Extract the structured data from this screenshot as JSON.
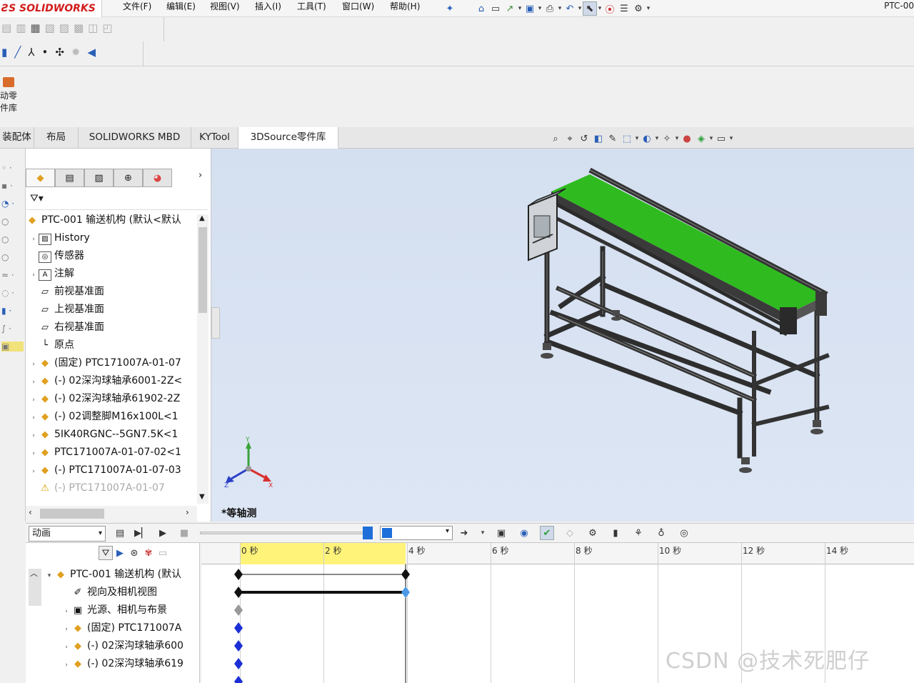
{
  "app": {
    "logo_text": "SOLIDWORKS",
    "product_text": "PTC-00"
  },
  "menu": [
    "文件(F)",
    "编辑(E)",
    "视图(V)",
    "插入(I)",
    "工具(T)",
    "窗口(W)",
    "帮助(H)"
  ],
  "ribbon": {
    "big_button_label_line1": "动零",
    "big_button_label_line2": "件库"
  },
  "tabs": [
    "装配体",
    "布局",
    "SOLIDWORKS MBD",
    "KYTool",
    "3DSource零件库"
  ],
  "active_tab": "3DSource零件库",
  "feature_tree": {
    "root": "PTC-001 输送机构 (默认<默认",
    "items": [
      {
        "label": "History",
        "expand": true,
        "icon": "history-icon"
      },
      {
        "label": "传感器",
        "expand": false,
        "icon": "sensor-icon"
      },
      {
        "label": "注解",
        "expand": true,
        "icon": "annotation-icon"
      },
      {
        "label": "前视基准面",
        "expand": false,
        "icon": "plane-icon"
      },
      {
        "label": "上视基准面",
        "expand": false,
        "icon": "plane-icon"
      },
      {
        "label": "右视基准面",
        "expand": false,
        "icon": "plane-icon"
      },
      {
        "label": "原点",
        "expand": false,
        "icon": "origin-icon"
      },
      {
        "label": "(固定) PTC171007A-01-07",
        "expand": true,
        "icon": "part-icon"
      },
      {
        "label": "(-) 02深沟球轴承6001-2Z<",
        "expand": true,
        "icon": "part-icon"
      },
      {
        "label": "(-) 02深沟球轴承61902-2Z",
        "expand": true,
        "icon": "part-icon"
      },
      {
        "label": "(-) 02调整脚M16x100L<1",
        "expand": true,
        "icon": "part-icon"
      },
      {
        "label": "5IK40RGNC--5GN7.5K<1",
        "expand": true,
        "icon": "part-icon"
      },
      {
        "label": "PTC171007A-01-07-02<1",
        "expand": true,
        "icon": "part-icon"
      },
      {
        "label": "(-) PTC171007A-01-07-03",
        "expand": true,
        "icon": "part-icon"
      },
      {
        "label": "(-) PTC171007A-01-07",
        "expand": false,
        "icon": "warning-icon",
        "dim": true
      }
    ]
  },
  "viewport": {
    "view_name": "*等轴测"
  },
  "motion": {
    "study_type": "动画",
    "root": "PTC-001 输送机构 (默认",
    "items": [
      {
        "label": "视向及相机视图",
        "icon": "camera-icon"
      },
      {
        "label": "光源、相机与布景",
        "icon": "light-icon"
      },
      {
        "label": "(固定) PTC171007A",
        "icon": "part-icon"
      },
      {
        "label": "(-) 02深沟球轴承600",
        "icon": "part-icon"
      },
      {
        "label": "(-) 02深沟球轴承619",
        "icon": "part-icon"
      }
    ],
    "time_labels": [
      "0 秒",
      "2 秒",
      "4 秒",
      "6 秒",
      "8 秒",
      "10 秒",
      "12 秒",
      "14 秒"
    ]
  },
  "watermark": "CSDN @技术死肥仔",
  "colors": {
    "belt": "#2fbb1f",
    "frame": "#3a3a3a",
    "viewport_bg": "#d8e3f3",
    "time_highlight": "#fff37a",
    "key_blue": "#1c2fd6"
  }
}
